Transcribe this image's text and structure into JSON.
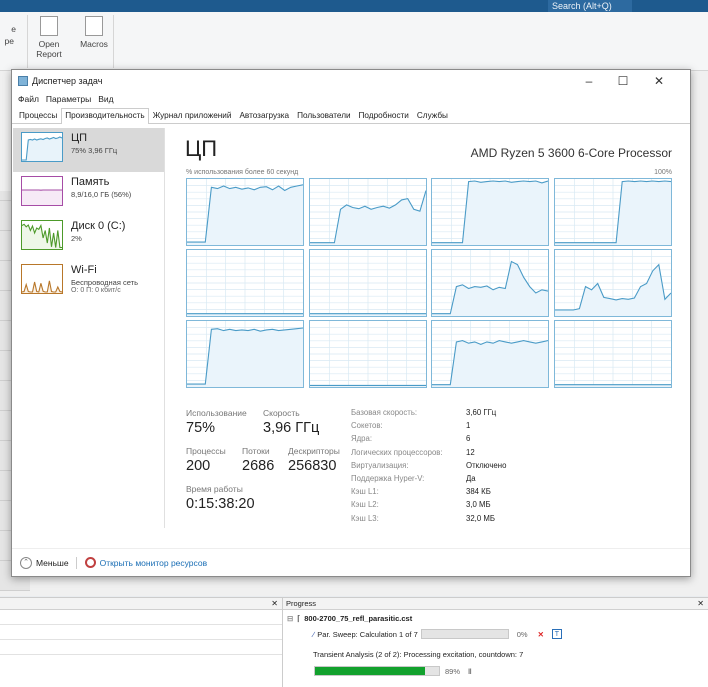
{
  "app": {
    "search_placeholder": "Search (Alt+Q)",
    "ribbon": {
      "open_report": "Open Report",
      "macros": "Macros",
      "partial1": "e",
      "partial2": "pe"
    }
  },
  "window": {
    "title": "Диспетчер задач",
    "menu": [
      "Файл",
      "Параметры",
      "Вид"
    ],
    "tabs": [
      "Процессы",
      "Производительность",
      "Журнал приложений",
      "Автозагрузка",
      "Пользователи",
      "Подробности",
      "Службы"
    ],
    "active_tab": 1
  },
  "sidebar": [
    {
      "title": "ЦП",
      "sub": "75% 3,96 ГГц",
      "color": "#4a9bc7",
      "fill": "#e8f3fa",
      "trace": [
        0,
        0,
        0,
        80,
        82,
        80,
        84,
        80,
        83,
        85,
        82,
        86,
        88,
        84,
        87,
        90,
        86,
        88,
        92,
        88
      ]
    },
    {
      "title": "Память",
      "sub": "8,9/16,0 ГБ (56%)",
      "color": "#a64ca6",
      "fill": "#f6eaf6",
      "trace": [
        56,
        56,
        56,
        56,
        56,
        56,
        56,
        56,
        56,
        55,
        56,
        56,
        56,
        56,
        56,
        56,
        56,
        56,
        56,
        56
      ]
    },
    {
      "title": "Диск 0 (C:)",
      "sub": "2%",
      "color": "#4d9a2a",
      "fill": "#eef7e8",
      "trace": [
        90,
        95,
        85,
        92,
        70,
        88,
        60,
        80,
        75,
        90,
        40,
        70,
        20,
        80,
        5,
        60,
        2,
        70,
        2,
        2
      ]
    },
    {
      "title": "Wi-Fi",
      "sub": "Беспроводная сеть",
      "sub2": "О: 0 П: 0 кбит/с",
      "color": "#b8772a",
      "fill": "#fbf1e4",
      "trace": [
        0,
        2,
        30,
        2,
        0,
        0,
        40,
        2,
        0,
        35,
        3,
        0,
        0,
        45,
        2,
        0,
        0,
        20,
        2,
        0
      ]
    }
  ],
  "cpu": {
    "heading": "ЦП",
    "processor": "AMD Ryzen 5 3600 6-Core Processor",
    "graph_caption": "% использования более 60 секунд",
    "graph_max": "100%",
    "stats": {
      "usage_label": "Использование",
      "usage": "75%",
      "speed_label": "Скорость",
      "speed": "3,96 ГГц",
      "proc_label": "Процессы",
      "proc": "200",
      "threads_label": "Потоки",
      "threads": "2686",
      "handles_label": "Дескрипторы",
      "handles": "256830",
      "uptime_label": "Время работы",
      "uptime": "0:15:38:20"
    },
    "details": [
      [
        "Базовая скорость:",
        "3,60 ГГц"
      ],
      [
        "Сокетов:",
        "1"
      ],
      [
        "Ядра:",
        "6"
      ],
      [
        "Логических процессоров:",
        "12"
      ],
      [
        "Виртуализация:",
        "Отключено"
      ],
      [
        "Поддержка Hyper-V:",
        "Да"
      ],
      [
        "Кэш L1:",
        "384 КБ"
      ],
      [
        "Кэш L2:",
        "3,0 МБ"
      ],
      [
        "Кэш L3:",
        "32,0 МБ"
      ]
    ]
  },
  "footer": {
    "less": "Меньше",
    "resmon": "Открыть монитор ресурсов"
  },
  "chart_data": {
    "type": "line",
    "title": "% использования более 60 секунд",
    "ylim": [
      0,
      100
    ],
    "series": [
      {
        "name": "CPU 0",
        "values": [
          3,
          3,
          3,
          3,
          90,
          88,
          92,
          88,
          90,
          87,
          89,
          86,
          90,
          91,
          86,
          92,
          85,
          90,
          92,
          94
        ]
      },
      {
        "name": "CPU 1",
        "values": [
          2,
          2,
          2,
          2,
          2,
          55,
          62,
          58,
          56,
          60,
          55,
          58,
          60,
          57,
          62,
          70,
          72,
          55,
          52,
          85
        ]
      },
      {
        "name": "CPU 2",
        "values": [
          2,
          2,
          2,
          2,
          2,
          2,
          99,
          100,
          98,
          99,
          100,
          99,
          100,
          98,
          99,
          100,
          99,
          100,
          97,
          100
        ]
      },
      {
        "name": "CPU 3",
        "values": [
          2,
          2,
          2,
          2,
          2,
          2,
          2,
          2,
          2,
          2,
          2,
          99,
          100,
          99,
          100,
          99,
          100,
          99,
          100,
          99
        ]
      },
      {
        "name": "CPU 4",
        "values": [
          2,
          2,
          2,
          2,
          2,
          2,
          2,
          2,
          2,
          2,
          2,
          2,
          2,
          2,
          2,
          2,
          2,
          2,
          2,
          2
        ]
      },
      {
        "name": "CPU 5",
        "values": [
          2,
          2,
          2,
          2,
          2,
          2,
          2,
          2,
          2,
          2,
          2,
          2,
          2,
          2,
          2,
          2,
          2,
          2,
          2,
          2
        ]
      },
      {
        "name": "CPU 6",
        "values": [
          2,
          2,
          2,
          2,
          45,
          48,
          42,
          45,
          44,
          46,
          40,
          44,
          42,
          85,
          80,
          60,
          45,
          35,
          40,
          38
        ]
      },
      {
        "name": "CPU 7",
        "values": [
          8,
          8,
          8,
          8,
          10,
          45,
          40,
          50,
          28,
          26,
          24,
          26,
          25,
          27,
          45,
          50,
          70,
          80,
          25,
          35
        ]
      },
      {
        "name": "CPU 8",
        "values": [
          3,
          3,
          3,
          3,
          90,
          91,
          88,
          90,
          88,
          89,
          88,
          90,
          87,
          89,
          90,
          88,
          89,
          90,
          91,
          92
        ]
      },
      {
        "name": "CPU 9",
        "values": [
          1,
          1,
          1,
          1,
          1,
          1,
          1,
          1,
          1,
          1,
          1,
          1,
          1,
          1,
          1,
          1,
          1,
          1,
          1,
          1
        ]
      },
      {
        "name": "CPU 10",
        "values": [
          2,
          2,
          2,
          2,
          70,
          72,
          68,
          70,
          66,
          70,
          68,
          72,
          70,
          68,
          70,
          72,
          70,
          68,
          70,
          72
        ]
      },
      {
        "name": "CPU 11",
        "values": [
          2,
          2,
          2,
          2,
          2,
          2,
          2,
          2,
          2,
          2,
          2,
          2,
          2,
          2,
          2,
          2,
          2,
          2,
          2,
          2
        ]
      }
    ]
  },
  "progress": {
    "header": "Progress",
    "file": "800-2700_75_refl_parasitic.cst",
    "sweep": "Par. Sweep: Calculation 1 of 7",
    "sweep_pct": "0%",
    "sweep_value": 0,
    "transient": "Transient Analysis (2 of 2): Processing excitation, countdown: 7",
    "transient_pct": "89%",
    "transient_value": 89
  }
}
